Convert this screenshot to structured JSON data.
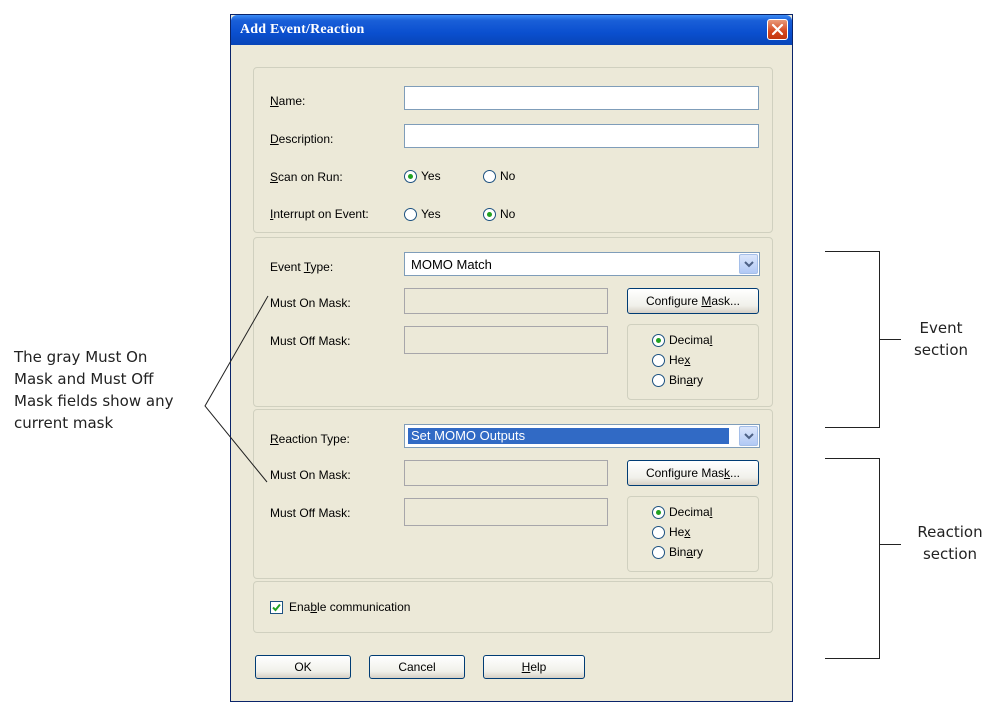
{
  "window": {
    "title": "Add Event/Reaction"
  },
  "general": {
    "name_label": "Name:",
    "name_value": "",
    "description_label": "Description:",
    "description_value": "",
    "scan_label": "Scan on Run:",
    "scan_selected": "Yes",
    "interrupt_label": "Interrupt on Event:",
    "interrupt_selected": "No",
    "yes": "Yes",
    "no": "No"
  },
  "event": {
    "type_label": "Event Type:",
    "type_value": "MOMO Match",
    "must_on_label": "Must On Mask:",
    "must_off_label": "Must Off Mask:",
    "configure_label": "Configure Mask...",
    "format_selected": "Decimal",
    "decimal": "Decimal",
    "hex": "Hex",
    "binary": "Binary"
  },
  "reaction": {
    "type_label": "Reaction Type:",
    "type_value": "Set MOMO Outputs",
    "must_on_label": "Must On Mask:",
    "must_off_label": "Must Off Mask:",
    "configure_label": "Configure Mask...",
    "format_selected": "Decimal",
    "decimal": "Decimal",
    "hex": "Hex",
    "binary": "Binary"
  },
  "enable_comm": {
    "label": "Enable communication",
    "checked": true
  },
  "buttons": {
    "ok": "OK",
    "cancel": "Cancel",
    "help": "Help"
  },
  "annotations": {
    "left": [
      "The gray Must On",
      "Mask and Must Off",
      "Mask fields show any",
      "current mask"
    ],
    "event_section": [
      "Event",
      "section"
    ],
    "reaction_section": [
      "Reaction",
      "section"
    ]
  },
  "colors": {
    "titlebar": "#0a4fcf",
    "dialog_bg": "#ece9d8",
    "selection": "#316ac5",
    "radio_on": "#21a121"
  }
}
